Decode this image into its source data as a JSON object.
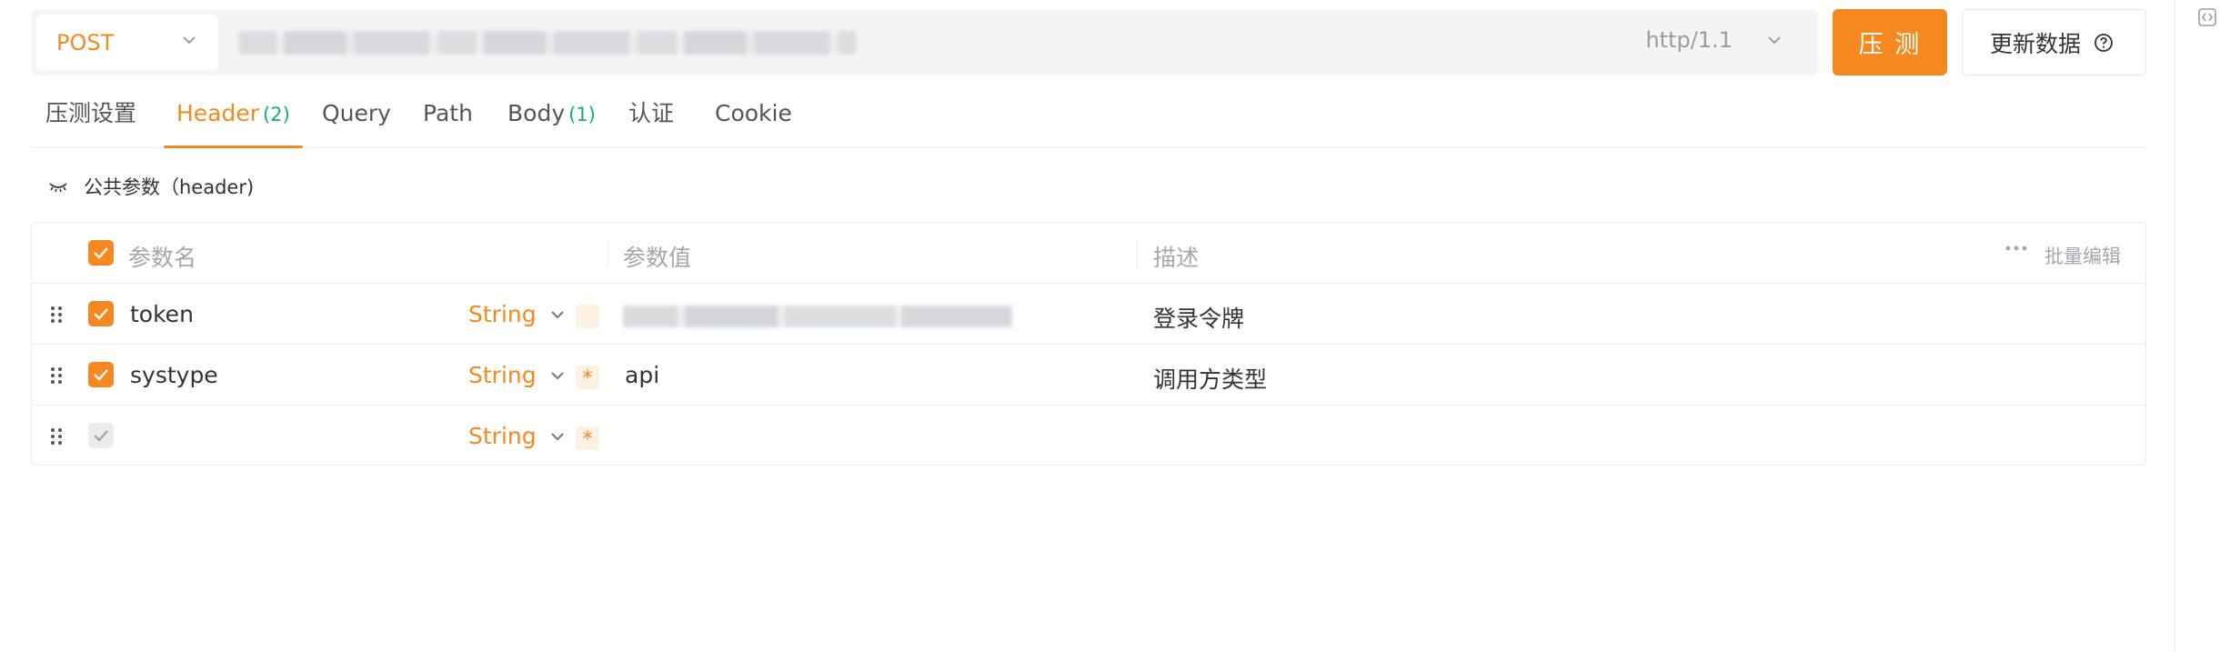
{
  "request": {
    "method": "POST",
    "url": "",
    "http_version": "http/1.1",
    "test_button": "压 测",
    "update_button": "更新数据"
  },
  "tabs": [
    {
      "label": "压测设置",
      "count": ""
    },
    {
      "label": "Header",
      "count": "(2)"
    },
    {
      "label": "Query",
      "count": ""
    },
    {
      "label": "Path",
      "count": ""
    },
    {
      "label": "Body",
      "count": "(1)"
    },
    {
      "label": "认证",
      "count": ""
    },
    {
      "label": "Cookie",
      "count": ""
    }
  ],
  "active_tab": "Header",
  "section": {
    "title": "公共参数（header)"
  },
  "table": {
    "columns": {
      "name": "参数名",
      "value": "参数值",
      "description": "描述",
      "batch_edit": "批量编辑"
    },
    "rows": [
      {
        "name": "token",
        "type": "String",
        "required": "",
        "value": "",
        "description": "登录令牌",
        "checked": true
      },
      {
        "name": "systype",
        "type": "String",
        "required": "*",
        "value": "api",
        "description": "调用方类型",
        "checked": true
      },
      {
        "name": "",
        "type": "String",
        "required": "*",
        "value": "",
        "description": "",
        "checked": false
      }
    ]
  },
  "colors": {
    "accent": "#f5891f",
    "count": "#17b26a",
    "muted": "#a4a7ad"
  }
}
